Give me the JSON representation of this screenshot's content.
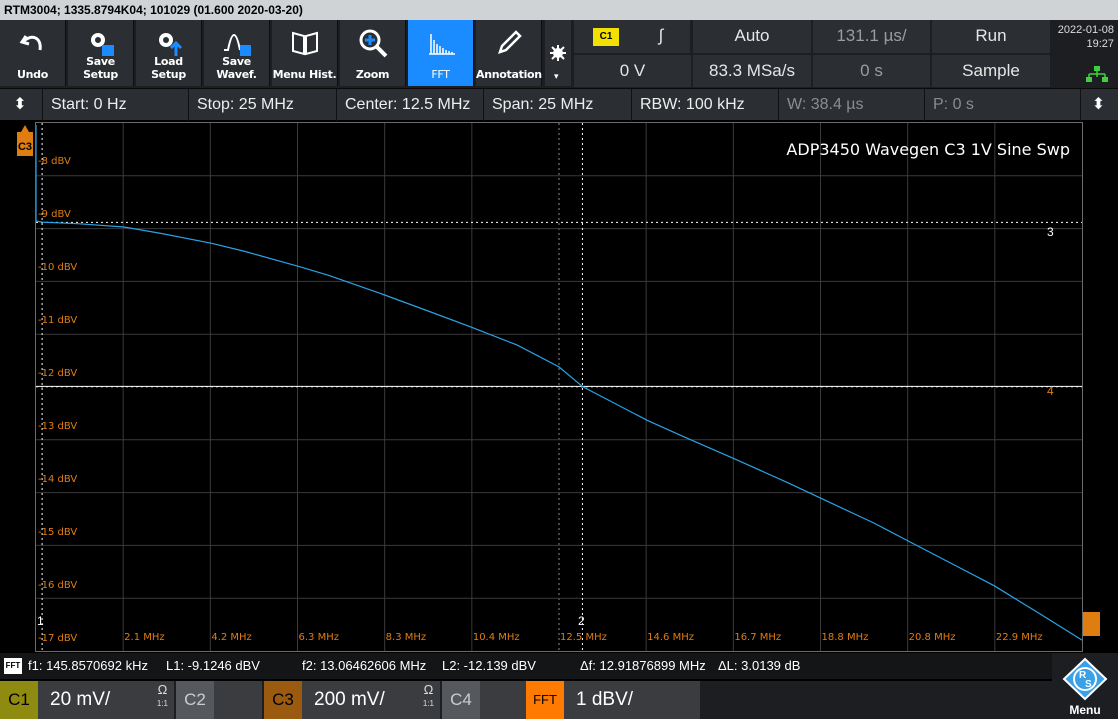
{
  "title_bar": "RTM3004; 1335.8794K04; 101029 (01.600 2020-03-20)",
  "toolbar": {
    "undo": "Undo",
    "save_setup": "Save Setup",
    "load_setup": "Load Setup",
    "save_waveform": "Save Wavef.",
    "menu_hist": "Menu Hist.",
    "zoom": "Zoom",
    "fft": "FFT",
    "annotation": "Annotation"
  },
  "trigger": {
    "channel": "C1",
    "slope_symbol": "∫",
    "mode": "Auto",
    "time_scale": "131.1 µs/",
    "run_state": "Run",
    "level": "0 V",
    "sample_rate": "83.3 MSa/s",
    "position": "0 s",
    "acquisition": "Sample"
  },
  "datetime": {
    "date": "2022-01-08",
    "time": "19:27"
  },
  "params": {
    "start": "Start: 0 Hz",
    "stop": "Stop: 25 MHz",
    "center": "Center: 12.5 MHz",
    "span": "Span: 25 MHz",
    "rbw": "RBW: 100 kHz",
    "window": "W: 38.4 µs",
    "position": "P: 0 s"
  },
  "annotation_text": "ADP3450 Wavegen C3 1V Sine Swp",
  "y_labels": [
    "-8 dBV",
    "-9 dBV",
    "-10 dBV",
    "-11 dBV",
    "-12 dBV",
    "-13 dBV",
    "-14 dBV",
    "-15 dBV",
    "-16 dBV",
    "-17 dBV"
  ],
  "x_labels": [
    "2.1 MHz",
    "4.2 MHz",
    "6.3 MHz",
    "8.3 MHz",
    "10.4 MHz",
    "12.5 MHz",
    "14.6 MHz",
    "16.7 MHz",
    "18.8 MHz",
    "20.8 MHz",
    "22.9 MHz"
  ],
  "cursor_labels": {
    "v1": "1",
    "v2": "2",
    "h3": "3",
    "h4": "4"
  },
  "channel_marker": "C3",
  "measurements": {
    "badge": "FFT",
    "f1": "f1: 145.8570692 kHz",
    "l1": "L1: -9.1246 dBV",
    "f2": "f2: 13.06462606 MHz",
    "l2": "L2: -12.139 dBV",
    "df": "Δf: 12.91876899 MHz",
    "dl": "ΔL: 3.0139 dB"
  },
  "channels": [
    {
      "tag": "C1",
      "value": "20 mV/",
      "ohm": "Ω",
      "ratio": "1:1",
      "color": "#f2e100"
    },
    {
      "tag": "C2",
      "value": "",
      "ohm": "",
      "ratio": "",
      "color": "#2f9e3a"
    },
    {
      "tag": "C3",
      "value": "200 mV/",
      "ohm": "Ω",
      "ratio": "1:1",
      "color": "#e07d10"
    },
    {
      "tag": "C4",
      "value": "",
      "ohm": "",
      "ratio": "",
      "color": "#3a7bd5"
    },
    {
      "tag": "FFT",
      "value": "1 dBV/",
      "ohm": "",
      "ratio": "",
      "color": "#ff7a00"
    }
  ],
  "menu_label": "Menu",
  "colors": {
    "trace": "#2aa3e6",
    "accent_orange": "#e07d10",
    "fft_active": "#1a8cff",
    "c1_yellow": "#f2e100"
  },
  "chart_data": {
    "type": "line",
    "xlabel": "",
    "ylabel": "",
    "x_unit": "MHz",
    "y_unit": "dBV",
    "xlim": [
      0,
      25
    ],
    "ylim": [
      -17,
      -7.3
    ],
    "series": [
      {
        "x": [
          0.0,
          0.146,
          1.0,
          2.1,
          3.0,
          4.2,
          5.0,
          6.3,
          7.0,
          8.3,
          9.5,
          10.4,
          11.5,
          12.5,
          13.06,
          14.6,
          15.5,
          16.7,
          18.0,
          18.8,
          20.0,
          20.8,
          22.0,
          22.9,
          24.0,
          25.0
        ],
        "y": [
          -9.1,
          -9.12,
          -9.15,
          -9.21,
          -9.33,
          -9.51,
          -9.66,
          -9.94,
          -10.1,
          -10.45,
          -10.79,
          -11.05,
          -11.38,
          -11.78,
          -12.14,
          -12.76,
          -13.07,
          -13.47,
          -13.92,
          -14.21,
          -14.64,
          -14.96,
          -15.44,
          -15.8,
          -16.32,
          -16.8
        ]
      }
    ],
    "markers": {
      "f1": 0.146,
      "f2": 13.06,
      "L1": -9.1246,
      "L2": -12.139
    }
  }
}
